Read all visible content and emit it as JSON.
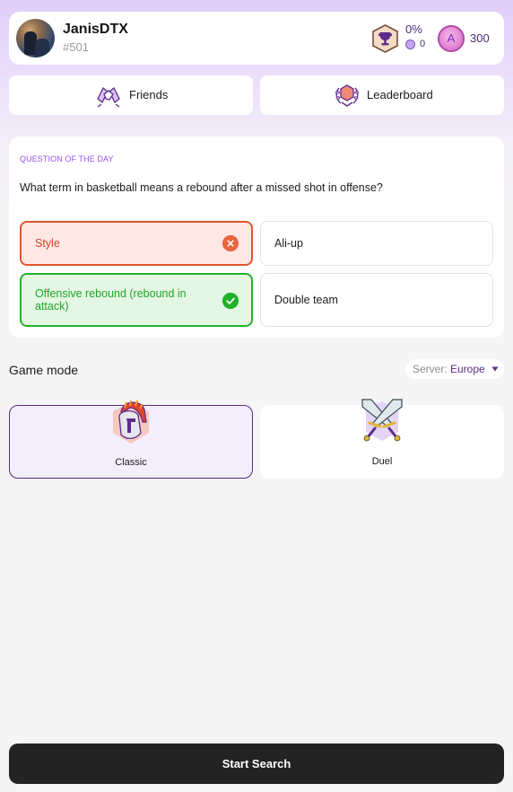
{
  "profile": {
    "username": "JanisDTX",
    "tag": "#501",
    "win_rate": "0%",
    "small_coins": "0",
    "a_badge_letter": "A",
    "a_points": "300"
  },
  "nav": {
    "friends_label": "Friends",
    "leaderboard_label": "Leaderboard"
  },
  "question": {
    "heading": "QUESTION OF THE DAY",
    "text": "What term in basketball means a rebound after a missed shot in offense?",
    "options": [
      {
        "label": "Style",
        "state": "wrong"
      },
      {
        "label": "Ali-up",
        "state": "neutral"
      },
      {
        "label": "Offensive rebound (rebound in attack)",
        "state": "correct"
      },
      {
        "label": "Double team",
        "state": "neutral"
      }
    ]
  },
  "game_mode": {
    "title": "Game mode",
    "server_label": "Server:",
    "server_value": "Europe",
    "modes": [
      {
        "label": "Classic",
        "icon": "spartan-helmet-icon",
        "selected": true
      },
      {
        "label": "Duel",
        "icon": "crossed-swords-icon",
        "selected": false
      }
    ]
  },
  "start_button": "Start Search",
  "colors": {
    "accent_purple": "#5c2a86",
    "wrong_red": "#e4542f",
    "correct_green": "#25b12d",
    "start_bg": "#232323"
  }
}
